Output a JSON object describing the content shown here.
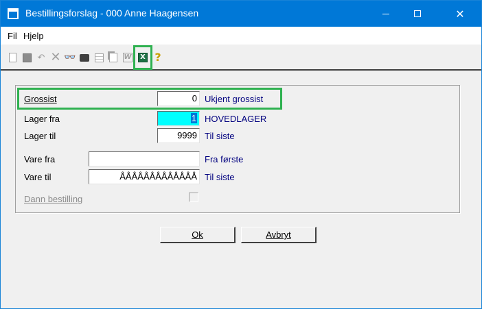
{
  "window": {
    "title": "Bestillingsforslag - 000 Anne Haagensen",
    "controls": {
      "minimize": "",
      "maximize": "",
      "close": "✕"
    }
  },
  "menu": {
    "items": [
      {
        "label": "Fil"
      },
      {
        "label": "Hjelp"
      }
    ]
  },
  "toolbar": {
    "icons": [
      "new-document-icon",
      "save-icon",
      "undo-icon",
      "delete-icon",
      "find-icon",
      "print-icon",
      "grid-icon",
      "copy-icon",
      "word-export-icon",
      "excel-export-icon",
      "help-icon"
    ],
    "undo_glyph": "↶",
    "delete_glyph": "✕",
    "find_glyph": "👓",
    "word_glyph": "W",
    "excel_glyph": "X",
    "help_glyph": "?",
    "highlight_color": "#2fb150"
  },
  "form": {
    "grossist": {
      "label": "Grossist",
      "value": "0",
      "desc": "Ukjent grossist"
    },
    "lager_fra": {
      "label": "Lager fra",
      "value": "1",
      "desc": "HOVEDLAGER"
    },
    "lager_til": {
      "label": "Lager til",
      "value": "9999",
      "desc": "Til siste"
    },
    "vare_fra": {
      "label": "Vare fra",
      "value": "",
      "desc": "Fra første"
    },
    "vare_til": {
      "label": "Vare til",
      "value": "ÅÅÅÅÅÅÅÅÅÅÅÅÅ",
      "desc": "Til siste"
    },
    "dann_bestilling": {
      "label": "Dann bestilling",
      "checked": false,
      "enabled": false
    }
  },
  "buttons": {
    "ok": "Ok",
    "avbryt": "Avbryt"
  },
  "colors": {
    "titlebar": "#0078d7",
    "description_text": "#00007f",
    "active_field": "#00ffff",
    "highlight": "#2fb150"
  }
}
